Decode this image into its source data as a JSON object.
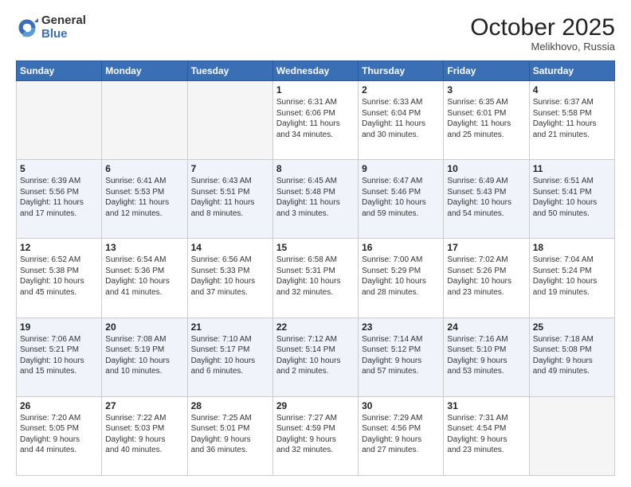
{
  "header": {
    "logo_general": "General",
    "logo_blue": "Blue",
    "month": "October 2025",
    "location": "Melikhovo, Russia"
  },
  "days_of_week": [
    "Sunday",
    "Monday",
    "Tuesday",
    "Wednesday",
    "Thursday",
    "Friday",
    "Saturday"
  ],
  "weeks": [
    [
      {
        "day": "",
        "text": ""
      },
      {
        "day": "",
        "text": ""
      },
      {
        "day": "",
        "text": ""
      },
      {
        "day": "1",
        "text": "Sunrise: 6:31 AM\nSunset: 6:06 PM\nDaylight: 11 hours\nand 34 minutes."
      },
      {
        "day": "2",
        "text": "Sunrise: 6:33 AM\nSunset: 6:04 PM\nDaylight: 11 hours\nand 30 minutes."
      },
      {
        "day": "3",
        "text": "Sunrise: 6:35 AM\nSunset: 6:01 PM\nDaylight: 11 hours\nand 25 minutes."
      },
      {
        "day": "4",
        "text": "Sunrise: 6:37 AM\nSunset: 5:58 PM\nDaylight: 11 hours\nand 21 minutes."
      }
    ],
    [
      {
        "day": "5",
        "text": "Sunrise: 6:39 AM\nSunset: 5:56 PM\nDaylight: 11 hours\nand 17 minutes."
      },
      {
        "day": "6",
        "text": "Sunrise: 6:41 AM\nSunset: 5:53 PM\nDaylight: 11 hours\nand 12 minutes."
      },
      {
        "day": "7",
        "text": "Sunrise: 6:43 AM\nSunset: 5:51 PM\nDaylight: 11 hours\nand 8 minutes."
      },
      {
        "day": "8",
        "text": "Sunrise: 6:45 AM\nSunset: 5:48 PM\nDaylight: 11 hours\nand 3 minutes."
      },
      {
        "day": "9",
        "text": "Sunrise: 6:47 AM\nSunset: 5:46 PM\nDaylight: 10 hours\nand 59 minutes."
      },
      {
        "day": "10",
        "text": "Sunrise: 6:49 AM\nSunset: 5:43 PM\nDaylight: 10 hours\nand 54 minutes."
      },
      {
        "day": "11",
        "text": "Sunrise: 6:51 AM\nSunset: 5:41 PM\nDaylight: 10 hours\nand 50 minutes."
      }
    ],
    [
      {
        "day": "12",
        "text": "Sunrise: 6:52 AM\nSunset: 5:38 PM\nDaylight: 10 hours\nand 45 minutes."
      },
      {
        "day": "13",
        "text": "Sunrise: 6:54 AM\nSunset: 5:36 PM\nDaylight: 10 hours\nand 41 minutes."
      },
      {
        "day": "14",
        "text": "Sunrise: 6:56 AM\nSunset: 5:33 PM\nDaylight: 10 hours\nand 37 minutes."
      },
      {
        "day": "15",
        "text": "Sunrise: 6:58 AM\nSunset: 5:31 PM\nDaylight: 10 hours\nand 32 minutes."
      },
      {
        "day": "16",
        "text": "Sunrise: 7:00 AM\nSunset: 5:29 PM\nDaylight: 10 hours\nand 28 minutes."
      },
      {
        "day": "17",
        "text": "Sunrise: 7:02 AM\nSunset: 5:26 PM\nDaylight: 10 hours\nand 23 minutes."
      },
      {
        "day": "18",
        "text": "Sunrise: 7:04 AM\nSunset: 5:24 PM\nDaylight: 10 hours\nand 19 minutes."
      }
    ],
    [
      {
        "day": "19",
        "text": "Sunrise: 7:06 AM\nSunset: 5:21 PM\nDaylight: 10 hours\nand 15 minutes."
      },
      {
        "day": "20",
        "text": "Sunrise: 7:08 AM\nSunset: 5:19 PM\nDaylight: 10 hours\nand 10 minutes."
      },
      {
        "day": "21",
        "text": "Sunrise: 7:10 AM\nSunset: 5:17 PM\nDaylight: 10 hours\nand 6 minutes."
      },
      {
        "day": "22",
        "text": "Sunrise: 7:12 AM\nSunset: 5:14 PM\nDaylight: 10 hours\nand 2 minutes."
      },
      {
        "day": "23",
        "text": "Sunrise: 7:14 AM\nSunset: 5:12 PM\nDaylight: 9 hours\nand 57 minutes."
      },
      {
        "day": "24",
        "text": "Sunrise: 7:16 AM\nSunset: 5:10 PM\nDaylight: 9 hours\nand 53 minutes."
      },
      {
        "day": "25",
        "text": "Sunrise: 7:18 AM\nSunset: 5:08 PM\nDaylight: 9 hours\nand 49 minutes."
      }
    ],
    [
      {
        "day": "26",
        "text": "Sunrise: 7:20 AM\nSunset: 5:05 PM\nDaylight: 9 hours\nand 44 minutes."
      },
      {
        "day": "27",
        "text": "Sunrise: 7:22 AM\nSunset: 5:03 PM\nDaylight: 9 hours\nand 40 minutes."
      },
      {
        "day": "28",
        "text": "Sunrise: 7:25 AM\nSunset: 5:01 PM\nDaylight: 9 hours\nand 36 minutes."
      },
      {
        "day": "29",
        "text": "Sunrise: 7:27 AM\nSunset: 4:59 PM\nDaylight: 9 hours\nand 32 minutes."
      },
      {
        "day": "30",
        "text": "Sunrise: 7:29 AM\nSunset: 4:56 PM\nDaylight: 9 hours\nand 27 minutes."
      },
      {
        "day": "31",
        "text": "Sunrise: 7:31 AM\nSunset: 4:54 PM\nDaylight: 9 hours\nand 23 minutes."
      },
      {
        "day": "",
        "text": ""
      }
    ]
  ]
}
